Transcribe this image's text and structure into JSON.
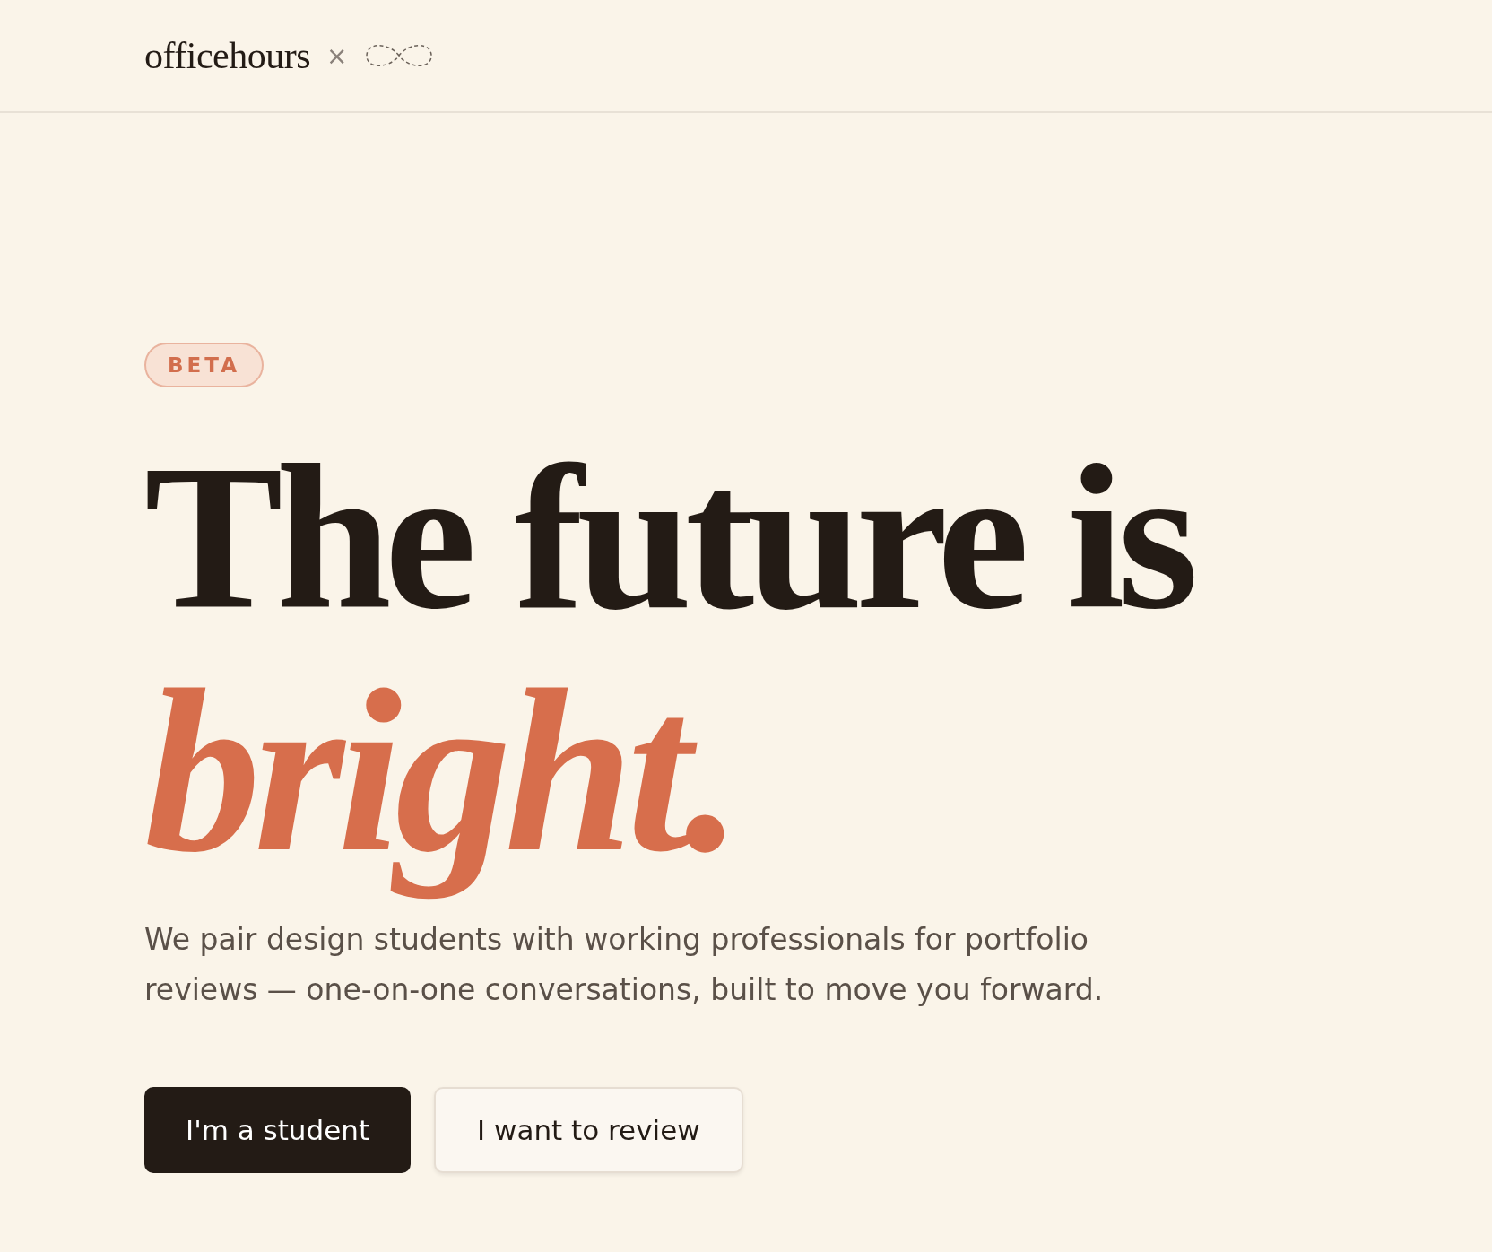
{
  "header": {
    "brand": "officehours",
    "separator": "×"
  },
  "hero": {
    "badge": "BETA",
    "headline": "The future is",
    "headline_accent": "bright.",
    "description": "We pair design students with working professionals for portfolio reviews — one-on-one conversations, built to move you forward.",
    "buttons": [
      {
        "label": "I'm a student",
        "kind": "primary"
      },
      {
        "label": "I want to review",
        "kind": "secondary"
      }
    ]
  }
}
